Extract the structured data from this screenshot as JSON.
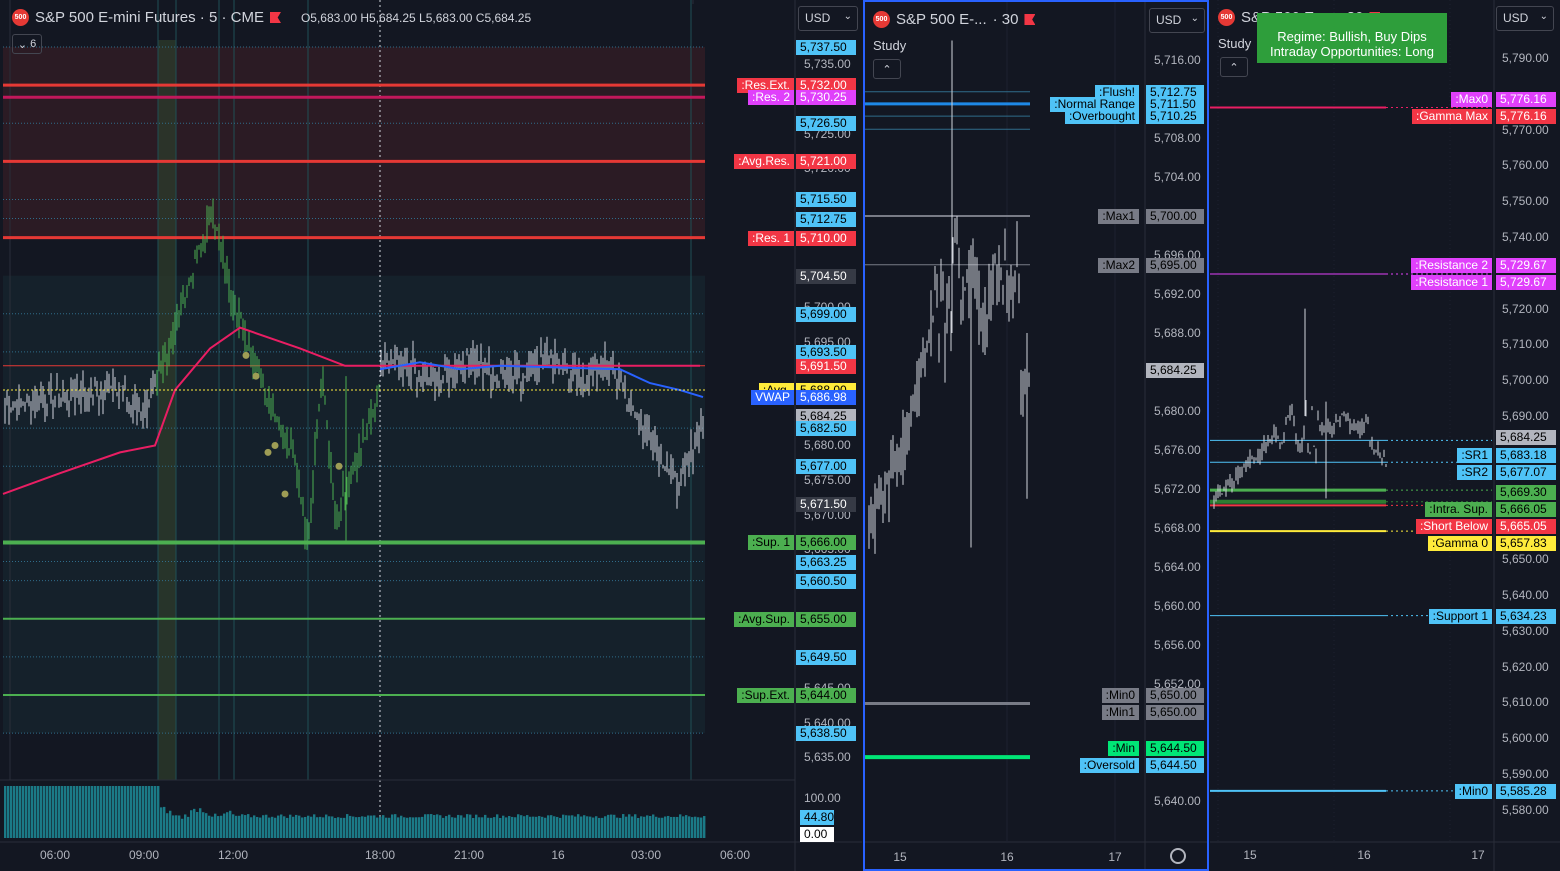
{
  "colors": {
    "bg": "#131722",
    "candle_up": "#4caf50",
    "candle": "#d1d4dc",
    "vwap": "#2962ff",
    "avg_line": "#e91e63",
    "blue_tag": "#4fc3f7",
    "red_tag": "#f23645",
    "pink_tag": "#e040fb",
    "green_tag": "#4caf50",
    "yellow_tag": "#ffeb3b"
  },
  "pane1": {
    "symbol": "S&P 500 E-mini Futures · 5 · CME",
    "logo": "500",
    "ohlc": "O5,683.00  H5,684.25  L5,683.00  C5,684.25",
    "currency": "USD",
    "indicator_count": "6",
    "y_ticks": [
      {
        "v": 5735,
        "l": "5,735.00"
      },
      {
        "v": 5725,
        "l": "5,725.00"
      },
      {
        "v": 5720,
        "l": "5,720.00"
      },
      {
        "v": 5700,
        "l": "5,700.00"
      },
      {
        "v": 5695,
        "l": "5,695.00"
      },
      {
        "v": 5680,
        "l": "5,680.00"
      },
      {
        "v": 5675,
        "l": "5,675.00"
      },
      {
        "v": 5670,
        "l": "5,670.00"
      },
      {
        "v": 5665,
        "l": "5,665.00"
      },
      {
        "v": 5645,
        "l": "5,645.00"
      },
      {
        "v": 5640,
        "l": "5,640.00"
      },
      {
        "v": 5635,
        "l": "5,635.00"
      }
    ],
    "price_tags": [
      {
        "v": 5737.5,
        "l": "5,737.50",
        "c": "blue"
      },
      {
        "v": 5732,
        "l": "5,732.00",
        "c": "red",
        "name": ":Res.Ext."
      },
      {
        "v": 5730.25,
        "l": "5,730.25",
        "c": "pink",
        "name": ":Res. 2"
      },
      {
        "v": 5726.5,
        "l": "5,726.50",
        "c": "blue"
      },
      {
        "v": 5721,
        "l": "5,721.00",
        "c": "red",
        "name": ":Avg.Res."
      },
      {
        "v": 5715.5,
        "l": "5,715.50",
        "c": "blue"
      },
      {
        "v": 5712.75,
        "l": "5,712.75",
        "c": "blue"
      },
      {
        "v": 5710,
        "l": "5,710.00",
        "c": "red",
        "name": ":Res. 1"
      },
      {
        "v": 5704.5,
        "l": "5,704.50",
        "c": "dark"
      },
      {
        "v": 5699,
        "l": "5,699.00",
        "c": "blue"
      },
      {
        "v": 5693.5,
        "l": "5,693.50",
        "c": "blue"
      },
      {
        "v": 5691.5,
        "l": "5,691.50",
        "c": "red"
      },
      {
        "v": 5688,
        "l": "5,688.00",
        "c": "yellow",
        "name": ":Avg."
      },
      {
        "v": 5686.98,
        "l": "5,686.98",
        "c": "vwap",
        "name": "VWAP"
      },
      {
        "v": 5684.25,
        "l": "5,684.25",
        "c": "grey"
      },
      {
        "v": 5682.5,
        "l": "5,682.50",
        "c": "blue"
      },
      {
        "v": 5677,
        "l": "5,677.00",
        "c": "blue"
      },
      {
        "v": 5671.5,
        "l": "5,671.50",
        "c": "dark"
      },
      {
        "v": 5666,
        "l": "5,666.00",
        "c": "green",
        "name": ":Sup. 1"
      },
      {
        "v": 5663.25,
        "l": "5,663.25",
        "c": "blue"
      },
      {
        "v": 5660.5,
        "l": "5,660.50",
        "c": "blue"
      },
      {
        "v": 5655,
        "l": "5,655.00",
        "c": "green",
        "name": ":Avg.Sup."
      },
      {
        "v": 5649.5,
        "l": "5,649.50",
        "c": "blue"
      },
      {
        "v": 5644,
        "l": "5,644.00",
        "c": "green",
        "name": ":Sup.Ext."
      },
      {
        "v": 5638.5,
        "l": "5,638.50",
        "c": "blue"
      }
    ],
    "volume_ticks": [
      {
        "l": "100.00"
      },
      {
        "l": "44.80"
      },
      {
        "l": "0.00"
      }
    ],
    "x_ticks": [
      "06:00",
      "09:00",
      "12:00",
      "18:00",
      "21:00",
      "16",
      "03:00",
      "06:00"
    ]
  },
  "pane2": {
    "symbol": "S&P 500 E-...",
    "interval": "· 30",
    "logo": "500",
    "currency": "USD",
    "study": "Study",
    "y_ticks": [
      {
        "v": 5716,
        "l": "5,716.00"
      },
      {
        "v": 5708,
        "l": "5,708.00"
      },
      {
        "v": 5704,
        "l": "5,704.00"
      },
      {
        "v": 5696,
        "l": "5,696.00"
      },
      {
        "v": 5692,
        "l": "5,692.00"
      },
      {
        "v": 5688,
        "l": "5,688.00"
      },
      {
        "v": 5680,
        "l": "5,680.00"
      },
      {
        "v": 5676,
        "l": "5,676.00"
      },
      {
        "v": 5672,
        "l": "5,672.00"
      },
      {
        "v": 5668,
        "l": "5,668.00"
      },
      {
        "v": 5664,
        "l": "5,664.00"
      },
      {
        "v": 5660,
        "l": "5,660.00"
      },
      {
        "v": 5656,
        "l": "5,656.00"
      },
      {
        "v": 5652,
        "l": "5,652.00"
      },
      {
        "v": 5640,
        "l": "5,640.00"
      }
    ],
    "price_tags": [
      {
        "v": 5712.75,
        "l": "5,712.75",
        "c": "blue",
        "name": ":Flush!"
      },
      {
        "v": 5711.5,
        "l": "5,711.50",
        "c": "blue",
        "name": ":Normal Range"
      },
      {
        "v": 5710.25,
        "l": "5,710.25",
        "c": "blue",
        "name": ":Overbought"
      },
      {
        "v": 5700,
        "l": "5,700.00",
        "c": "grey2",
        "name": ":Max1"
      },
      {
        "v": 5695,
        "l": "5,695.00",
        "c": "grey2",
        "name": ":Max2"
      },
      {
        "v": 5684.25,
        "l": "5,684.25",
        "c": "grey"
      },
      {
        "v": 5650,
        "l": "5,650.00",
        "c": "grey2",
        "name": ":Min0"
      },
      {
        "v": 5650,
        "l": "5,650.00",
        "c": "grey2",
        "name": ":Min1"
      },
      {
        "v": 5644.5,
        "l": "5,644.50",
        "c": "lime",
        "name": ":Min"
      },
      {
        "v": 5644.5,
        "l": "5,644.50",
        "c": "blue",
        "name": ":Oversold"
      }
    ],
    "x_ticks": [
      "15",
      "16",
      "17"
    ]
  },
  "pane3": {
    "symbol": "S&P 500 E-...",
    "interval": "· 30",
    "logo": "500",
    "currency": "USD",
    "study": "Study",
    "regime": [
      "Regime: Bullish, Buy Dips",
      "Intraday Opportunities: Long"
    ],
    "y_ticks": [
      {
        "v": 5790,
        "l": "5,790.00"
      },
      {
        "v": 5770,
        "l": "5,770.00"
      },
      {
        "v": 5760,
        "l": "5,760.00"
      },
      {
        "v": 5750,
        "l": "5,750.00"
      },
      {
        "v": 5740,
        "l": "5,740.00"
      },
      {
        "v": 5720,
        "l": "5,720.00"
      },
      {
        "v": 5710,
        "l": "5,710.00"
      },
      {
        "v": 5700,
        "l": "5,700.00"
      },
      {
        "v": 5690,
        "l": "5,690.00"
      },
      {
        "v": 5650,
        "l": "5,650.00"
      },
      {
        "v": 5640,
        "l": "5,640.00"
      },
      {
        "v": 5630,
        "l": "5,630.00"
      },
      {
        "v": 5620,
        "l": "5,620.00"
      },
      {
        "v": 5610,
        "l": "5,610.00"
      },
      {
        "v": 5600,
        "l": "5,600.00"
      },
      {
        "v": 5590,
        "l": "5,590.00"
      },
      {
        "v": 5580,
        "l": "5,580.00"
      }
    ],
    "price_tags": [
      {
        "v": 5776.16,
        "l": "5,776.16",
        "c": "pink",
        "name": ":Max0"
      },
      {
        "v": 5776.16,
        "l": "5,776.16",
        "c": "red",
        "name": ":Gamma Max"
      },
      {
        "v": 5729.67,
        "l": "5,729.67",
        "c": "pink",
        "name": ":Resistance 2"
      },
      {
        "v": 5729.67,
        "l": "5,729.67",
        "c": "pink",
        "name": ":Resistance 1"
      },
      {
        "v": 5684.25,
        "l": "5,684.25",
        "c": "grey"
      },
      {
        "v": 5683.18,
        "l": "5,683.18",
        "c": "blue",
        "name": ":SR1"
      },
      {
        "v": 5677.07,
        "l": "5,677.07",
        "c": "blue",
        "name": ":SR2"
      },
      {
        "v": 5669.3,
        "l": "5,669.30",
        "c": "green"
      },
      {
        "v": 5666.05,
        "l": "5,666.05",
        "c": "green",
        "name": ":Intra. Sup."
      },
      {
        "v": 5665.05,
        "l": "5,665.05",
        "c": "red",
        "name": ":Short Below"
      },
      {
        "v": 5657.83,
        "l": "5,657.83",
        "c": "yellow",
        "name": ":Gamma 0"
      },
      {
        "v": 5634.23,
        "l": "5,634.23",
        "c": "blue",
        "name": ":Support 1"
      },
      {
        "v": 5585.28,
        "l": "5,585.28",
        "c": "blue",
        "name": ":Min0"
      }
    ],
    "x_ticks": [
      "15",
      "16",
      "17"
    ]
  }
}
